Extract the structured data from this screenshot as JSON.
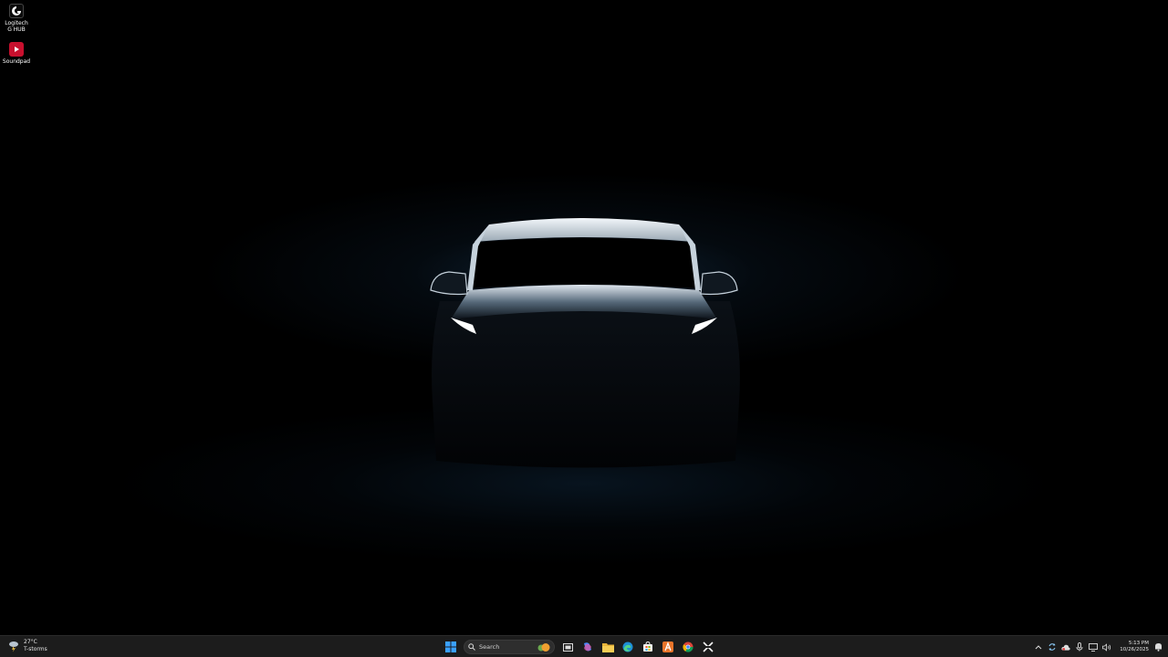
{
  "desktop": {
    "icons": [
      {
        "label": "Logitech G HUB",
        "icon": "logitech-g-hub-icon"
      },
      {
        "label": "Soundpad",
        "icon": "soundpad-icon"
      }
    ]
  },
  "wallpaper": {
    "subject": "car-silhouette",
    "accent": "#1c3e5c"
  },
  "taskbar": {
    "weather": {
      "temperature": "27°C",
      "condition": "T-storms",
      "icon": "thunderstorm-icon"
    },
    "search": {
      "label": "Search"
    },
    "pinned": [
      {
        "icon": "windows-start-icon"
      },
      {
        "icon": "task-view-icon"
      },
      {
        "icon": "copilot-icon"
      },
      {
        "icon": "file-explorer-icon"
      },
      {
        "icon": "edge-browser-icon"
      },
      {
        "icon": "microsoft-store-icon"
      },
      {
        "icon": "app-a-icon"
      },
      {
        "icon": "chrome-icon"
      },
      {
        "icon": "capcut-icon"
      }
    ],
    "tray": {
      "icons": [
        "chevron-up-icon",
        "sync-icon",
        "cloud-icon",
        "microphone-icon",
        "display-icon",
        "volume-icon"
      ],
      "time": "5:13 PM",
      "date": "10/26/2025",
      "notification_icon": "notification-bell-icon"
    }
  },
  "colors": {
    "taskbar_bg": "#1c1c1c",
    "start_blue": "#3aa0ff",
    "soundpad_red": "#c8102e"
  }
}
